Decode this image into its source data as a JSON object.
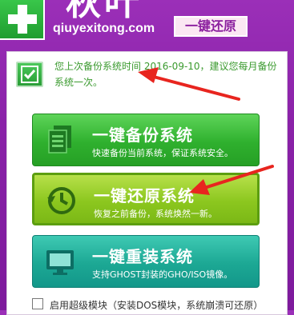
{
  "header": {
    "brand_title": "秋叶",
    "brand_url": "qiuyexitong.com",
    "mode_badge": "一键还原"
  },
  "notice": {
    "text": "您上次备份系统时间 2016-09-10，建议您每月备份系统一次。"
  },
  "actions": [
    {
      "title": "一键备份系统",
      "desc": "快速备份当前系统，保证系统安全。",
      "icon": "document-stack-icon"
    },
    {
      "title": "一键还原系统",
      "desc": "恢复之前备份，系统焕然一新。",
      "icon": "restore-clock-icon"
    },
    {
      "title": "一键重装系统",
      "desc": "支持GHOST封装的GHO/ISO镜像。",
      "icon": "monitor-icon"
    }
  ],
  "option": {
    "label": "启用超级模块（安装DOS模块，系统崩溃可还原）",
    "checked": false
  },
  "colors": {
    "background": "#8a22a8",
    "notice_text": "#3a9a2e",
    "annotation_arrow": "#e8251f"
  }
}
